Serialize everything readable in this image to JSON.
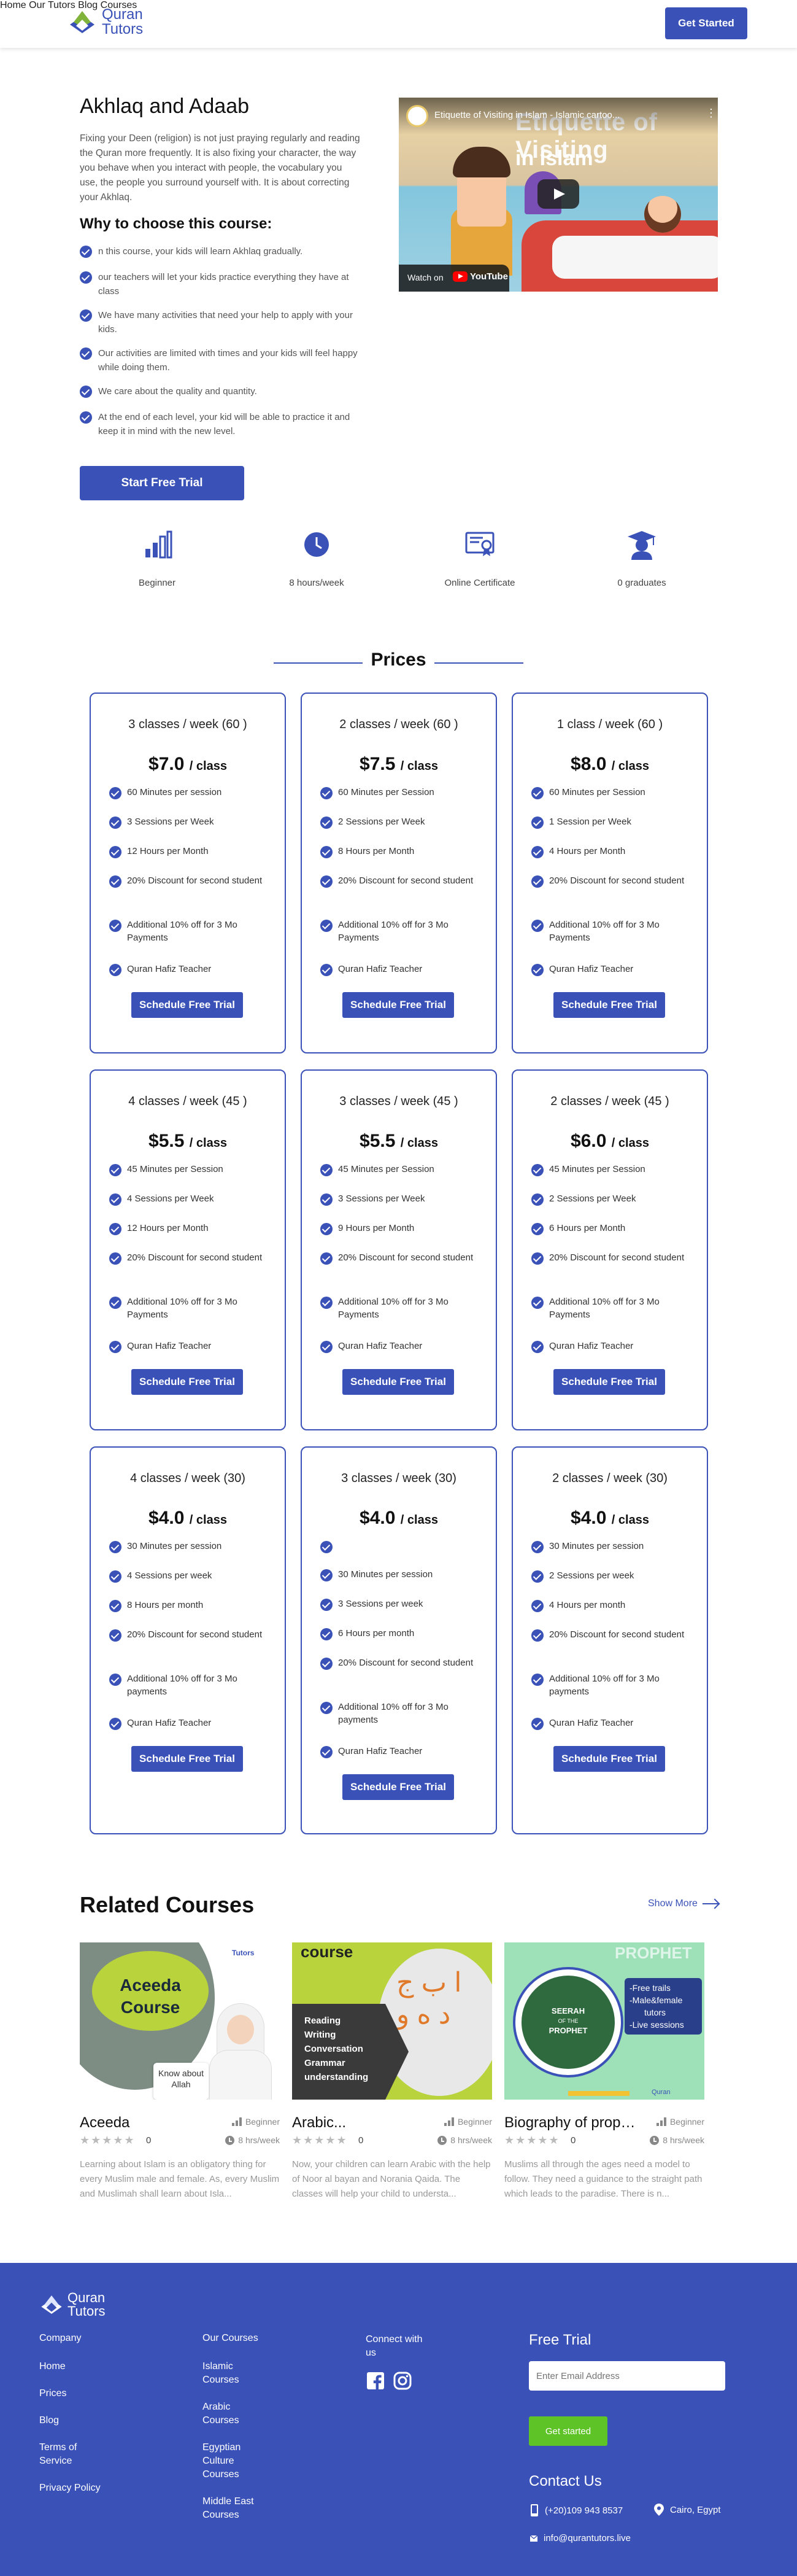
{
  "header": {
    "logo_line1": "Quran",
    "logo_line2": "Tutors",
    "nav": [
      "Home",
      "Our Tutors",
      "Blog",
      "Courses"
    ],
    "cta": "Get Started"
  },
  "course": {
    "title": "Akhlaq and Adaab",
    "description": "Fixing your Deen (religion) is not just praying regularly and reading the Quran more frequently. It is also fixing your character, the way you behave when you interact with people, the vocabulary you use, the people you surround yourself with. It is about correcting your Akhlaq.",
    "why_title": "Why to choose this course:",
    "why_items": [
      "n this course, your kids will learn Akhlaq gradually.",
      "our teachers will let your kids practice everything they have at class",
      "We have many activities that need your help to apply with your kids.",
      "Our activities are limited with times and your kids will feel happy while doing them.",
      "We care about the quality and quantity.",
      "At the end of each level, your kid will be able to practice it and keep it in mind with the new level."
    ],
    "trial_button": "Start Free Trial"
  },
  "video": {
    "title": "Etiquette of Visiting in Islam - Islamic cartoo...",
    "overlay_line1": "Etiquette of Visiting",
    "overlay_line2": "in Islam",
    "watch_on": "Watch on",
    "youtube": "YouTube"
  },
  "features": [
    {
      "icon": "bar-chart-icon",
      "label": "Beginner"
    },
    {
      "icon": "clock-icon",
      "label": "8 hours/week"
    },
    {
      "icon": "certificate-icon",
      "label": "Online Certificate"
    },
    {
      "icon": "graduate-icon",
      "label": "0 graduates"
    }
  ],
  "prices": {
    "title": "Prices",
    "unit": "/ class",
    "button": "Schedule Free Trial",
    "plans": [
      {
        "title": "3 classes / week (60 )",
        "price": "$7.0",
        "items": [
          "60 Minutes per session",
          "3 Sessions per Week",
          "12 Hours per Month",
          "20% Discount for second student",
          "Additional 10% off for 3 Mo Payments",
          "Quran Hafiz Teacher"
        ]
      },
      {
        "title": "2 classes / week (60 )",
        "price": "$7.5",
        "items": [
          "60 Minutes per Session",
          "2 Sessions per Week",
          "8 Hours per Month",
          "20% Discount for second student",
          "Additional 10% off for 3 Mo Payments",
          "Quran Hafiz Teacher"
        ]
      },
      {
        "title": "1 class / week (60 )",
        "price": "$8.0",
        "items": [
          "60 Minutes per Session",
          "1 Session per Week",
          "4 Hours per Month",
          "20% Discount for second student",
          "Additional 10% off for 3 Mo Payments",
          "Quran Hafiz Teacher"
        ]
      },
      {
        "title": "4 classes / week (45 )",
        "price": "$5.5",
        "items": [
          "45 Minutes per Session",
          "4 Sessions per Week",
          "12 Hours per Month",
          "20% Discount for second student",
          "Additional 10% off for 3 Mo Payments",
          "Quran Hafiz Teacher"
        ]
      },
      {
        "title": "3 classes / week (45 )",
        "price": "$5.5",
        "items": [
          "45 Minutes per Session",
          "3 Sessions per Week",
          "9 Hours per Month",
          "20% Discount for second student",
          "Additional 10% off for 3 Mo Payments",
          "Quran Hafiz Teacher"
        ]
      },
      {
        "title": "2 classes / week (45 )",
        "price": "$6.0",
        "items": [
          "45 Minutes per Session",
          "2 Sessions per Week",
          "6 Hours per Month",
          "20% Discount for second student",
          "Additional 10% off for 3 Mo Payments",
          "Quran Hafiz Teacher"
        ]
      },
      {
        "title": "4 classes / week (30)",
        "price": "$4.0",
        "items": [
          "30 Minutes per session",
          "4 Sessions per week",
          "8 Hours per month",
          "20% Discount for second student",
          "Additional 10% off for 3 Mo payments",
          "Quran Hafiz Teacher"
        ]
      },
      {
        "title": "3 classes / week (30)",
        "price": "$4.0",
        "items": [
          "",
          "30 Minutes per session",
          "3 Sessions per week",
          "6 Hours per month",
          "20% Discount for second student",
          "Additional 10% off for 3 Mo payments",
          "Quran Hafiz Teacher"
        ]
      },
      {
        "title": "2 classes / week (30)",
        "price": "$4.0",
        "items": [
          "30 Minutes per session",
          "2 Sessions per week",
          "4 Hours per month",
          "20% Discount for second student",
          "Additional 10% off for 3 Mo payments",
          "Quran Hafiz Teacher"
        ]
      }
    ]
  },
  "related": {
    "title": "Related Courses",
    "show_more": "Show More",
    "courses": [
      {
        "name": "Aceeda",
        "level": "Beginner",
        "stars": "★★★★★",
        "count": "0",
        "hours": "8 hrs/week",
        "desc": "Learning about Islam is an obligatory thing for every Muslim male and female. As, every Muslim and Muslimah shall learn about Isla...",
        "img_line1": "Aceeda",
        "img_line2": "Course",
        "img_tag": "Know about",
        "img_tag2": "Allah",
        "img_brand": "Tutors"
      },
      {
        "name": "Arabic...",
        "level": "Beginner",
        "stars": "★★★★★",
        "count": "0",
        "hours": "8 hrs/week",
        "desc": "Now, your children can learn Arabic with the help of Noor al bayan and Norania Qaida. The classes will help your child to understa...",
        "img_head": "course",
        "img_list": [
          "Reading",
          "Writing",
          "Conversation",
          "Grammar",
          "understanding"
        ]
      },
      {
        "name": "Biography of prophet...",
        "level": "Beginner",
        "stars": "★★★★★",
        "count": "0",
        "hours": "8 hrs/week",
        "desc": "Muslims all through the ages need a model to follow. They need a guidance to the straight path which leads to the paradise. There is n...",
        "img_head": "PROPHET",
        "img_circle": "SEERAH",
        "img_circle2": "OF THE",
        "img_circle3": "PROPHET",
        "img_list": [
          "-Free trails",
          "-Male&female",
          "tutors",
          "-Live sessions"
        ],
        "img_foot": "Quran"
      }
    ]
  },
  "footer": {
    "logo_line1": "Quran",
    "logo_line2": "Tutors",
    "company_head": "Company",
    "company_links": [
      "Home",
      "Prices",
      "Blog",
      "Terms of Service",
      "Privacy Policy"
    ],
    "courses_head": "Our Courses",
    "courses_links": [
      "Islamic Courses",
      "Arabic Courses",
      "Egyptian Culture Courses",
      "Middle East Courses"
    ],
    "connect_head": "Connect with us",
    "free_trial": "Free Trial",
    "email_placeholder": "Enter Email Address",
    "get_started": "Get started",
    "contact_title": "Contact Us",
    "phone": "(+20)109 943 8537",
    "location": "Cairo, Egypt",
    "email": "info@qurantutors.live"
  },
  "colors": {
    "primary": "#3a52b8",
    "green": "#5ec326"
  }
}
